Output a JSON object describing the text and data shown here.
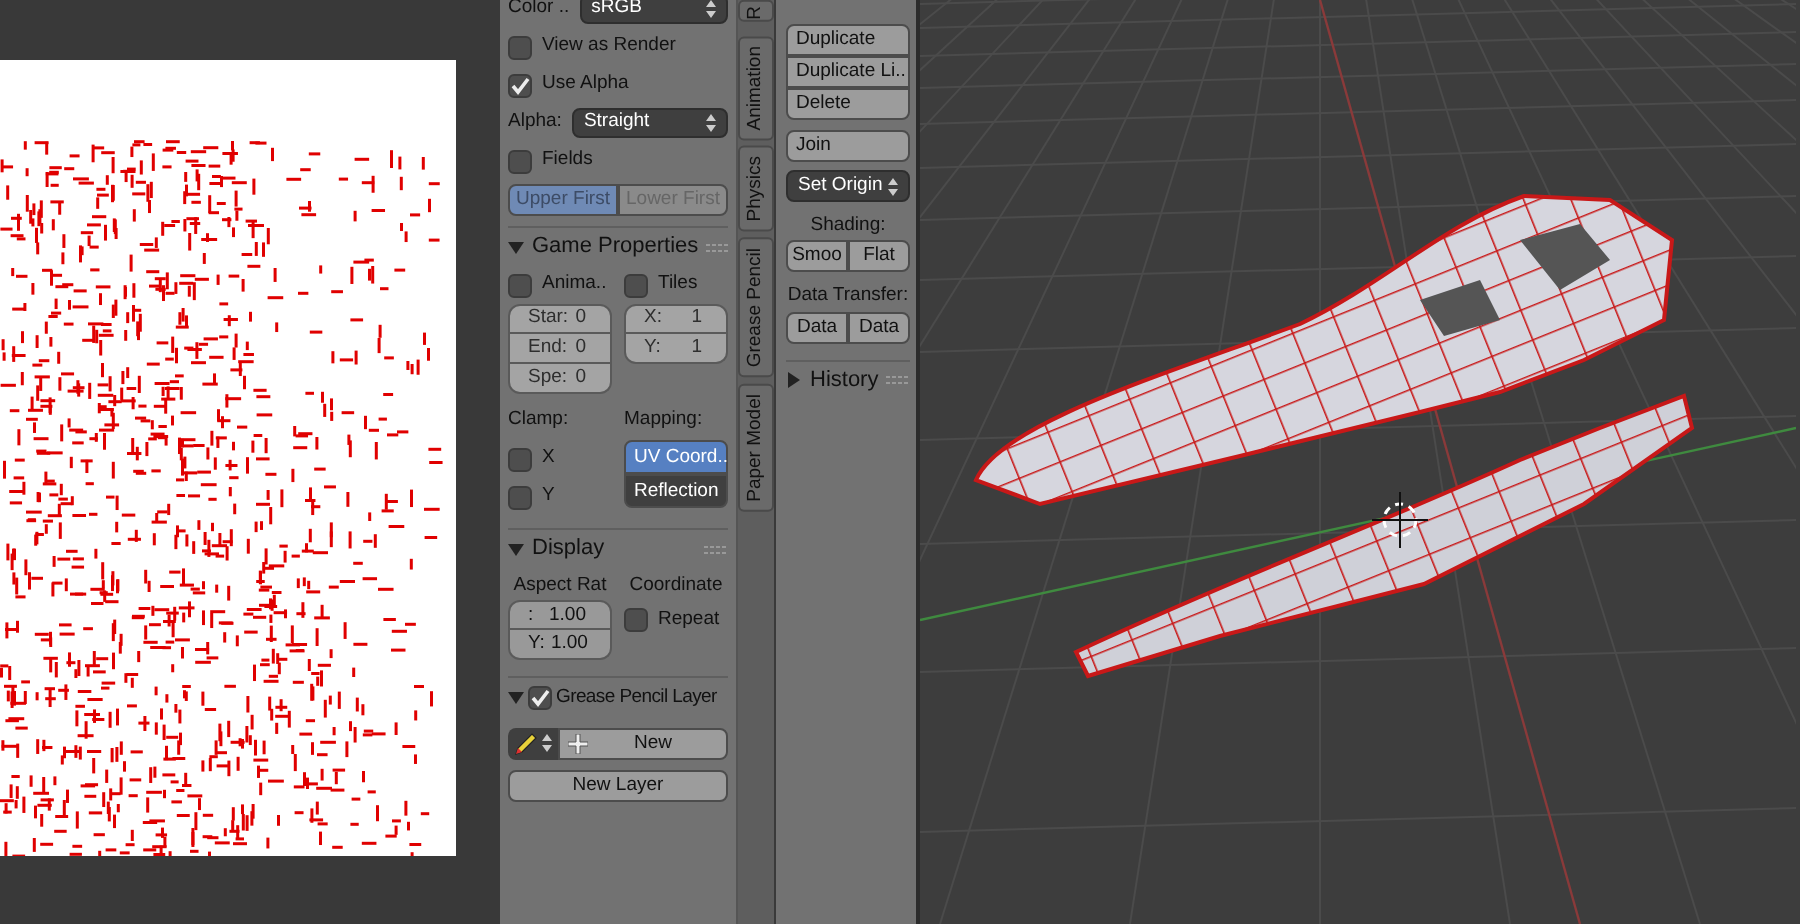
{
  "properties": {
    "color_space": {
      "label": "Color ..",
      "value": "sRGB"
    },
    "view_as_render": {
      "label": "View as Render",
      "checked": false
    },
    "use_alpha": {
      "label": "Use Alpha",
      "checked": true
    },
    "alpha": {
      "label": "Alpha:",
      "value": "Straight"
    },
    "fields": {
      "label": "Fields",
      "checked": false
    },
    "field_order": {
      "disabled": true,
      "options": [
        {
          "label": "Upper First",
          "selected": true
        },
        {
          "label": "Lower First",
          "selected": false
        }
      ]
    }
  },
  "game_properties": {
    "title": "Game Properties",
    "expanded": true,
    "animated": {
      "label": "Anima..",
      "checked": false
    },
    "tiles": {
      "label": "Tiles",
      "checked": false
    },
    "frame_fields": {
      "disabled": true,
      "items": [
        {
          "label": "Star:",
          "value": "0"
        },
        {
          "label": "End:",
          "value": "0"
        },
        {
          "label": "Spe:",
          "value": "0"
        }
      ]
    },
    "tile_fields": {
      "disabled": true,
      "items": [
        {
          "label": "X:",
          "value": "1"
        },
        {
          "label": "Y:",
          "value": "1"
        }
      ]
    },
    "clamp": {
      "label": "Clamp:",
      "options": [
        {
          "label": "X",
          "checked": false
        },
        {
          "label": "Y",
          "checked": false
        }
      ]
    },
    "mapping": {
      "label": "Mapping:",
      "options": [
        {
          "label": "UV Coord..",
          "selected": true
        },
        {
          "label": "Reflection",
          "selected": false
        }
      ]
    }
  },
  "display": {
    "title": "Display",
    "expanded": true,
    "aspect": {
      "label": "Aspect Rat",
      "fields": [
        {
          "label": ":",
          "value": "1.00"
        },
        {
          "label": "Y:",
          "value": "1.00"
        }
      ]
    },
    "coordinate": {
      "label": "Coordinate",
      "repeat": {
        "label": "Repeat",
        "checked": false
      }
    }
  },
  "grease_pencil_layer": {
    "title": "Grease Pencil Layer",
    "expanded": true,
    "checked": true,
    "new_button": "New",
    "new_layer_button": "New Layer"
  },
  "side_tabs": [
    {
      "label": "R",
      "selected": false
    },
    {
      "label": "Animation",
      "selected": false
    },
    {
      "label": "Physics",
      "selected": false
    },
    {
      "label": "Grease Pencil",
      "selected": false
    },
    {
      "label": "Paper Model",
      "selected": false
    }
  ],
  "tool_shelf": {
    "edit_buttons": [
      "Duplicate",
      "Duplicate Li..",
      "Delete"
    ],
    "join_button": "Join",
    "set_origin": "Set Origin",
    "shading": {
      "label": "Shading:",
      "buttons": [
        "Smoo",
        "Flat"
      ]
    },
    "data_transfer": {
      "label": "Data Transfer:",
      "buttons": [
        "Data",
        "Data"
      ]
    },
    "history": {
      "title": "History",
      "expanded": false
    }
  }
}
